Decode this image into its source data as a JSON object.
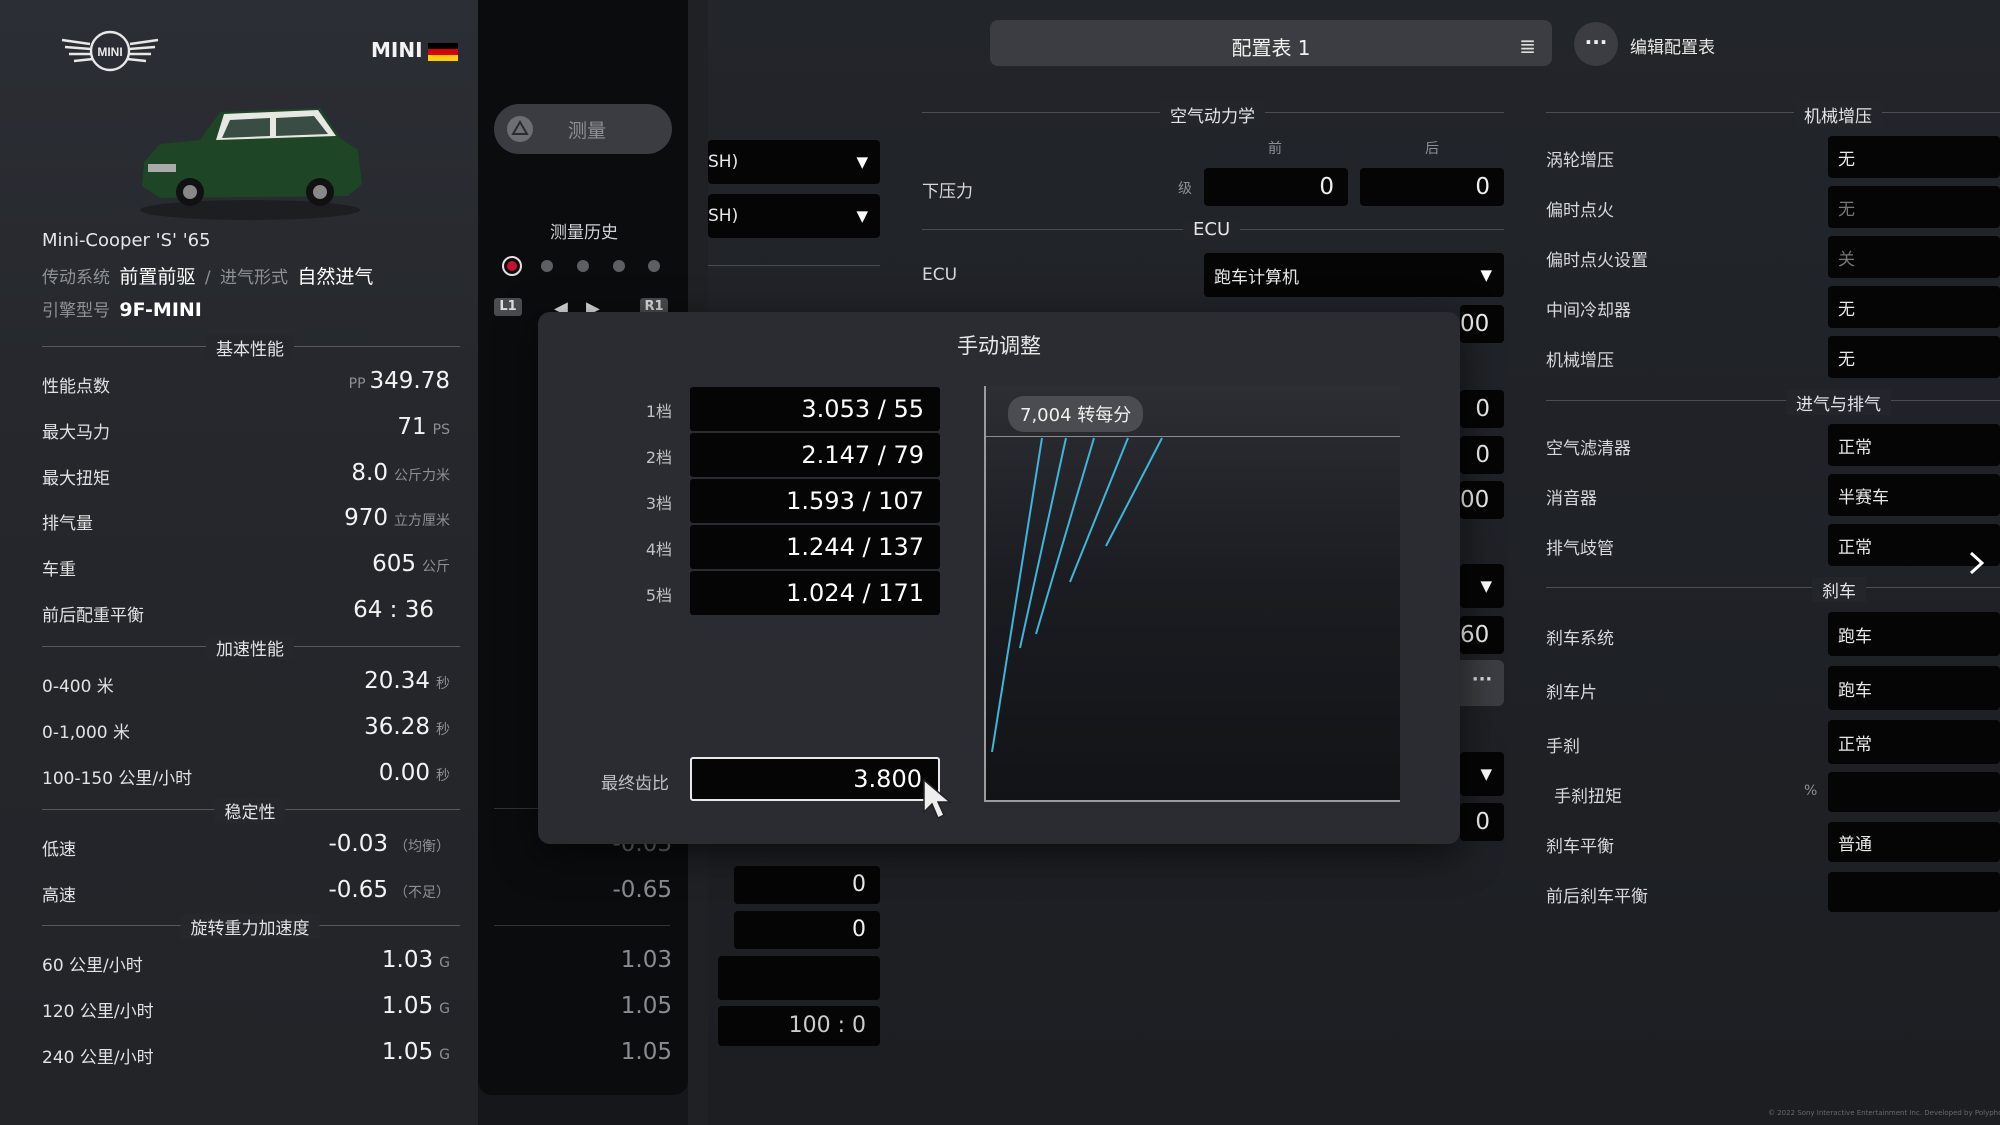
{
  "brand": {
    "logo_text": "MINI",
    "name": "MINI",
    "flag": "germany-flag-icon"
  },
  "car": {
    "model": "Mini-Cooper 'S' '65",
    "drivetrain_label": "传动系统",
    "drivetrain": "前置前驱",
    "sep": "/",
    "aspiration_label": "进气形式",
    "aspiration": "自然进气",
    "engine_label": "引擎型号",
    "engine": "9F-MINI"
  },
  "basic": {
    "title": "基本性能",
    "rows": [
      {
        "label": "性能点数",
        "prefix": "PP",
        "value": "349.78",
        "unit": ""
      },
      {
        "label": "最大马力",
        "prefix": "",
        "value": "71",
        "unit": "PS"
      },
      {
        "label": "最大扭矩",
        "prefix": "",
        "value": "8.0",
        "unit": "公斤力米"
      },
      {
        "label": "排气量",
        "prefix": "",
        "value": "970",
        "unit": "立方厘米"
      },
      {
        "label": "车重",
        "prefix": "",
        "value": "605",
        "unit": "公斤"
      },
      {
        "label": "前后配重平衡",
        "prefix": "",
        "value": "64 : 36",
        "unit": ""
      }
    ]
  },
  "accel": {
    "title": "加速性能",
    "rows": [
      {
        "label": "0-400 米",
        "value": "20.34",
        "unit": "秒"
      },
      {
        "label": "0-1,000 米",
        "value": "36.28",
        "unit": "秒"
      },
      {
        "label": "100-150 公里/小时",
        "value": "0.00",
        "unit": "秒"
      }
    ]
  },
  "stability": {
    "title": "稳定性",
    "rows": [
      {
        "label": "低速",
        "value": "-0.03",
        "unit": "（均衡）"
      },
      {
        "label": "高速",
        "value": "-0.65",
        "unit": "（不足）"
      }
    ]
  },
  "gforce": {
    "title": "旋转重力加速度",
    "rows": [
      {
        "label": "60 公里/小时",
        "value": "1.03",
        "unit": "G"
      },
      {
        "label": "120 公里/小时",
        "value": "1.05",
        "unit": "G"
      },
      {
        "label": "240 公里/小时",
        "value": "1.05",
        "unit": "G"
      }
    ]
  },
  "measure": {
    "button": "测量",
    "history": "测量历史",
    "l1": "L1",
    "r1": "R1",
    "vals": [
      "-0.03",
      "-0.65",
      "1.03",
      "1.05",
      "1.05"
    ]
  },
  "header": {
    "config": "配置表 1",
    "edit": "编辑配置表"
  },
  "aero": {
    "title": "空气动力学",
    "front": "前",
    "rear": "后",
    "downforce": "下压力",
    "level": "级",
    "front_val": "0",
    "rear_val": "0"
  },
  "ecu": {
    "title": "ECU",
    "label": "ECU",
    "value": "跑车计算机",
    "partial": "00"
  },
  "hidden_vals": {
    "v1": "0",
    "v2": "0",
    "v3": "00",
    "v4": "60",
    "v5": "0",
    "tire1": "SH)",
    "tire2": "SH)",
    "m0a": "0",
    "m0b": "0",
    "ratio": "100 : 0"
  },
  "supercharge": {
    "title": "机械增压",
    "rows": [
      {
        "label": "涡轮增压",
        "value": "无"
      },
      {
        "label": "偏时点火",
        "value": "无"
      },
      {
        "label": "偏时点火设置",
        "value": "关"
      },
      {
        "label": "中间冷却器",
        "value": "无"
      },
      {
        "label": "机械增压",
        "value": "无"
      }
    ]
  },
  "intake": {
    "title": "进气与排气",
    "rows": [
      {
        "label": "空气滤清器",
        "value": "正常"
      },
      {
        "label": "消音器",
        "value": "半赛车"
      },
      {
        "label": "排气歧管",
        "value": "正常"
      }
    ]
  },
  "brake": {
    "title": "刹车",
    "rows": [
      {
        "label": "刹车系统",
        "value": "跑车"
      },
      {
        "label": "刹车片",
        "value": "跑车"
      },
      {
        "label": "手刹",
        "value": "正常"
      },
      {
        "label": "手刹扭矩",
        "value": "",
        "unit": "%"
      },
      {
        "label": "刹车平衡",
        "value": "普通"
      },
      {
        "label": "前后刹车平衡",
        "value": ""
      }
    ]
  },
  "modal": {
    "title": "手动调整",
    "gears": [
      {
        "label": "1档",
        "value": "3.053 / 55"
      },
      {
        "label": "2档",
        "value": "2.147 / 79"
      },
      {
        "label": "3档",
        "value": "1.593 / 107"
      },
      {
        "label": "4档",
        "value": "1.244 / 137"
      },
      {
        "label": "5档",
        "value": "1.024 / 171"
      }
    ],
    "final_label": "最终齿比",
    "final_value": "3.800",
    "rpm": "7,004 转每分"
  },
  "footer": {
    "copyright": "© 2022 Sony Interactive Entertainment Inc. Developed by Polyphony Digital Inc."
  },
  "colors": {
    "gear_line": "#3fb6d8",
    "flag_black": "#000000",
    "flag_red": "#dd0000",
    "flag_gold": "#ffce00"
  }
}
